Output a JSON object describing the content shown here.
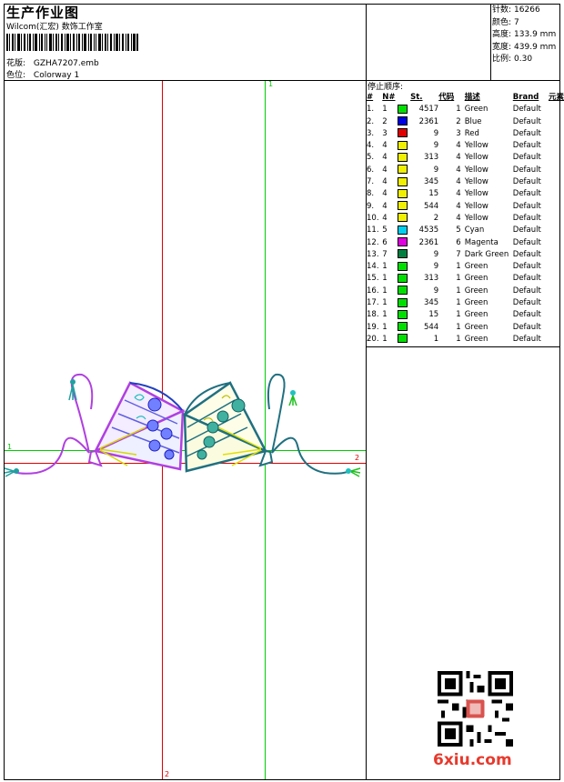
{
  "header": {
    "title": "生产作业图",
    "software": "Wilcom(汇宏) 数饰工作室",
    "pattern_label": "花版:",
    "pattern_value": "GZHA7207.emb",
    "colorway_label": "色位:",
    "colorway_value": "Colorway 1"
  },
  "stats": {
    "stitches_label": "针数:",
    "stitches": "16266",
    "colors_label": "颜色:",
    "colors": "7",
    "height_label": "高度:",
    "height": "133.9 mm",
    "width_label": "宽度:",
    "width": "439.9 mm",
    "scale_label": "比例:",
    "scale": "0.30"
  },
  "stop_sequence": {
    "title": "停止顺序:",
    "headers": [
      "#",
      "N#",
      "St.",
      "代码",
      "描述",
      "Brand",
      "元素"
    ],
    "rows": [
      {
        "idx": "1.",
        "n": "1",
        "color": "#00e000",
        "st": "4517",
        "code": "1",
        "desc": "Green",
        "brand": "Default"
      },
      {
        "idx": "2.",
        "n": "2",
        "color": "#0000e0",
        "st": "2361",
        "code": "2",
        "desc": "Blue",
        "brand": "Default"
      },
      {
        "idx": "3.",
        "n": "3",
        "color": "#e00000",
        "st": "9",
        "code": "3",
        "desc": "Red",
        "brand": "Default"
      },
      {
        "idx": "4.",
        "n": "4",
        "color": "#f0f000",
        "st": "9",
        "code": "4",
        "desc": "Yellow",
        "brand": "Default"
      },
      {
        "idx": "5.",
        "n": "4",
        "color": "#f0f000",
        "st": "313",
        "code": "4",
        "desc": "Yellow",
        "brand": "Default"
      },
      {
        "idx": "6.",
        "n": "4",
        "color": "#f0f000",
        "st": "9",
        "code": "4",
        "desc": "Yellow",
        "brand": "Default"
      },
      {
        "idx": "7.",
        "n": "4",
        "color": "#f0f000",
        "st": "345",
        "code": "4",
        "desc": "Yellow",
        "brand": "Default"
      },
      {
        "idx": "8.",
        "n": "4",
        "color": "#f0f000",
        "st": "15",
        "code": "4",
        "desc": "Yellow",
        "brand": "Default"
      },
      {
        "idx": "9.",
        "n": "4",
        "color": "#f0f000",
        "st": "544",
        "code": "4",
        "desc": "Yellow",
        "brand": "Default"
      },
      {
        "idx": "10.",
        "n": "4",
        "color": "#f0f000",
        "st": "2",
        "code": "4",
        "desc": "Yellow",
        "brand": "Default"
      },
      {
        "idx": "11.",
        "n": "5",
        "color": "#00d0f0",
        "st": "4535",
        "code": "5",
        "desc": "Cyan",
        "brand": "Default"
      },
      {
        "idx": "12.",
        "n": "6",
        "color": "#e000e0",
        "st": "2361",
        "code": "6",
        "desc": "Magenta",
        "brand": "Default"
      },
      {
        "idx": "13.",
        "n": "7",
        "color": "#008040",
        "st": "9",
        "code": "7",
        "desc": "Dark Green",
        "brand": "Default"
      },
      {
        "idx": "14.",
        "n": "1",
        "color": "#00e000",
        "st": "9",
        "code": "1",
        "desc": "Green",
        "brand": "Default"
      },
      {
        "idx": "15.",
        "n": "1",
        "color": "#00e000",
        "st": "313",
        "code": "1",
        "desc": "Green",
        "brand": "Default"
      },
      {
        "idx": "16.",
        "n": "1",
        "color": "#00e000",
        "st": "9",
        "code": "1",
        "desc": "Green",
        "brand": "Default"
      },
      {
        "idx": "17.",
        "n": "1",
        "color": "#00e000",
        "st": "345",
        "code": "1",
        "desc": "Green",
        "brand": "Default"
      },
      {
        "idx": "18.",
        "n": "1",
        "color": "#00e000",
        "st": "15",
        "code": "1",
        "desc": "Green",
        "brand": "Default"
      },
      {
        "idx": "19.",
        "n": "1",
        "color": "#00e000",
        "st": "544",
        "code": "1",
        "desc": "Green",
        "brand": "Default"
      },
      {
        "idx": "20.",
        "n": "1",
        "color": "#00e000",
        "st": "1",
        "code": "1",
        "desc": "Green",
        "brand": "Default"
      }
    ]
  },
  "axes": {
    "green_vertical_label": "1",
    "green_horizontal_label": "1",
    "red_horizontal_label": "2",
    "red_vertical_label": "2"
  },
  "colors": {
    "axis_green": "#00cc00",
    "axis_red": "#dd0000"
  },
  "watermark": "6xiu.com"
}
